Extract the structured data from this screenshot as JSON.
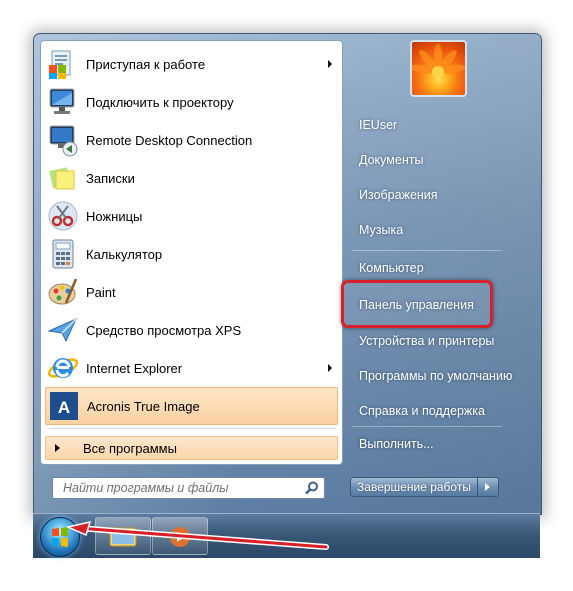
{
  "start_menu": {
    "programs": [
      {
        "label": "Приступая к работе",
        "icon": "getting-started-icon",
        "submenu": true
      },
      {
        "label": "Подключить к проектору",
        "icon": "projector-icon",
        "submenu": false
      },
      {
        "label": "Remote Desktop Connection",
        "icon": "remote-desktop-icon",
        "submenu": false
      },
      {
        "label": "Записки",
        "icon": "sticky-notes-icon",
        "submenu": false
      },
      {
        "label": "Ножницы",
        "icon": "scissors-icon",
        "submenu": false
      },
      {
        "label": "Калькулятор",
        "icon": "calculator-icon",
        "submenu": false
      },
      {
        "label": "Paint",
        "icon": "paint-palette-icon",
        "submenu": false
      },
      {
        "label": "Средство просмотра XPS",
        "icon": "xps-viewer-icon",
        "submenu": false
      },
      {
        "label": "Internet Explorer",
        "icon": "internet-explorer-icon",
        "submenu": true
      },
      {
        "label": "Acronis True Image",
        "icon": "acronis-icon",
        "submenu": false,
        "highlighted": true
      }
    ],
    "all_programs_label": "Все программы",
    "search_placeholder": "Найти программы и файлы",
    "right_items": [
      {
        "label": "IEUser"
      },
      {
        "label": "Документы"
      },
      {
        "label": "Изображения"
      },
      {
        "label": "Музыка"
      },
      {
        "label": "Компьютер"
      },
      {
        "label": "Панель управления",
        "highlighted": true
      },
      {
        "label": "Устройства и принтеры"
      },
      {
        "label": "Программы по умолчанию"
      },
      {
        "label": "Справка и поддержка"
      },
      {
        "label": "Выполнить..."
      }
    ],
    "shutdown_label": "Завершение работы"
  },
  "annotation_color": "#d8202a",
  "highlight_color": "#fbd1a1"
}
